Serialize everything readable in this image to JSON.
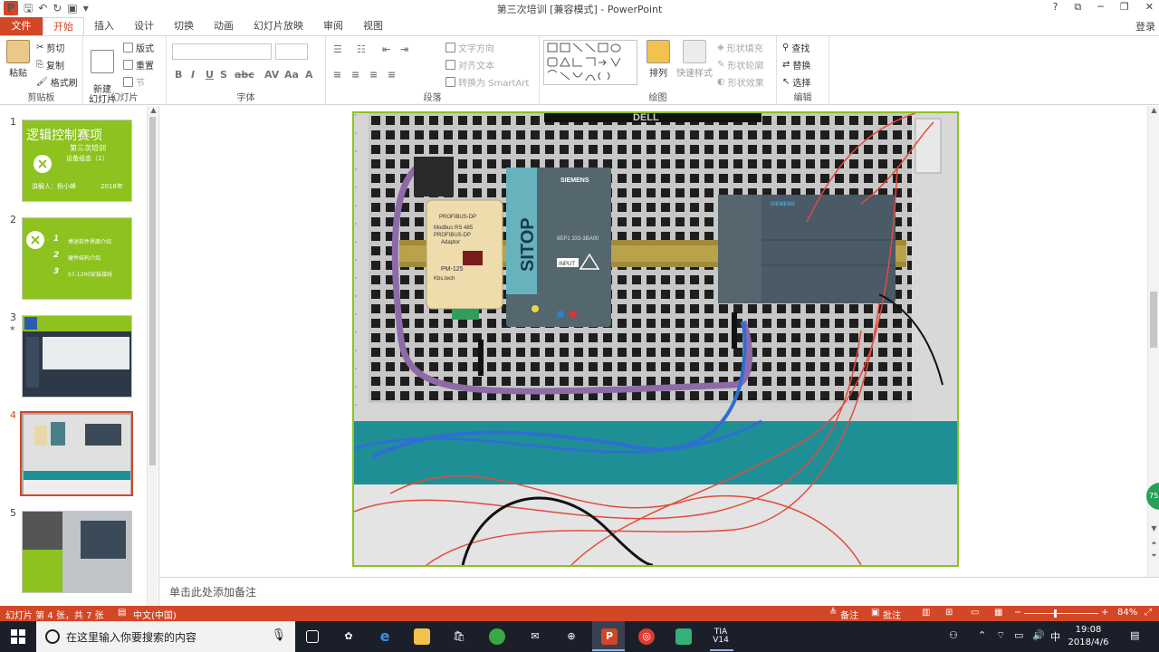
{
  "window": {
    "title": "第三次培训 [兼容模式] - PowerPoint",
    "controls": [
      "?",
      "⧉",
      "─",
      "❐",
      "✕"
    ],
    "login": "登录"
  },
  "tabs": [
    "文件",
    "开始",
    "插入",
    "设计",
    "切换",
    "动画",
    "幻灯片放映",
    "审阅",
    "视图"
  ],
  "active_tab": "开始",
  "ribbon": {
    "clipboard": {
      "label": "剪贴板",
      "paste": "粘贴",
      "cut": "剪切",
      "copy": "复制",
      "format_painter": "格式刷"
    },
    "slides": {
      "label": "幻灯片",
      "new_slide": "新建\n幻灯片",
      "layout": "版式",
      "reset": "重置",
      "section": "节"
    },
    "font": {
      "label": "字体"
    },
    "paragraph": {
      "label": "段落",
      "text_direction": "文字方向",
      "align_text": "对齐文本",
      "smartart": "转换为 SmartArt"
    },
    "drawing": {
      "label": "绘图",
      "arrange": "排列",
      "quick_styles": "快速样式",
      "shape_fill": "形状填充",
      "shape_outline": "形状轮廓",
      "shape_effects": "形状效果"
    },
    "editing": {
      "label": "编辑",
      "find": "查找",
      "replace": "替换",
      "select": "选择"
    }
  },
  "thumbnails": [
    {
      "num": "1",
      "title": "逻辑控制赛项",
      "sub1": "第三次培训",
      "sub2": "设备组态（1）",
      "lecturer": "讲解人：杨小峰",
      "year": "2018年"
    },
    {
      "num": "2",
      "items": [
        "博途软件界面介绍",
        "硬件结构介绍",
        "S7-1200安装接线"
      ],
      "item_nums": [
        "1",
        "2",
        "3"
      ]
    },
    {
      "num": "3"
    },
    {
      "num": "4"
    },
    {
      "num": "5"
    }
  ],
  "active_slide": 4,
  "notes_placeholder": "单击此处添加备注",
  "status": {
    "slide_info": "幻灯片 第 4 张，共 7 张",
    "language": "中文(中国)",
    "notes": "备注",
    "comments": "批注",
    "zoom": "84%"
  },
  "slide_photo": {
    "brand": "DELL",
    "module1_line1": "PROFIBUS-DP",
    "module1_line2": "Modbus RS 485",
    "module1_line3": "PROFIBUS-DP",
    "module1_line4": "Adaptor",
    "module1_model": "PM-125",
    "module1_maker": "Kbs.tech",
    "sitop": "SITOP",
    "siemens": "SIEMENS",
    "sitop_model": "6EP1 333-3BA00",
    "sitop_input": "INPUT",
    "plc_brand": "SIEMENS"
  },
  "taskbar": {
    "search_placeholder": "在这里输入你要搜索的内容",
    "time": "19:08",
    "date": "2018/4/6",
    "ime": "中",
    "tia_line1": "TIA",
    "tia_line2": "V14"
  },
  "colors": {
    "accent": "#d24726",
    "slide_green": "#8dc21f",
    "taskbar": "#1b1f2a"
  }
}
